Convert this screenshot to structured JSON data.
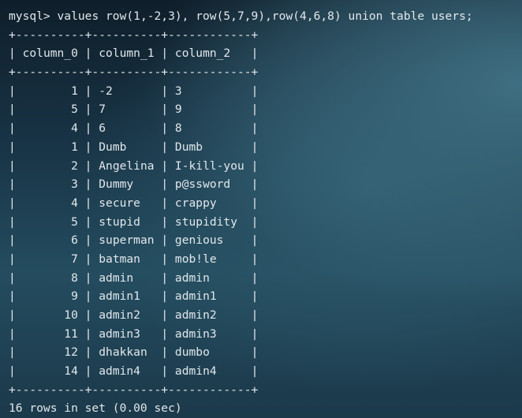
{
  "terminal": {
    "prompt": "mysql>",
    "command": "values row(1,-2,3), row(5,7,9),row(4,6,8) union table users;",
    "border": "+----------+----------+------------+",
    "columns": [
      "column_0",
      "column_1",
      "column_2"
    ],
    "rows": [
      [
        "1",
        "-2",
        "3"
      ],
      [
        "5",
        "7",
        "9"
      ],
      [
        "4",
        "6",
        "8"
      ],
      [
        "1",
        "Dumb",
        "Dumb"
      ],
      [
        "2",
        "Angelina",
        "I-kill-you"
      ],
      [
        "3",
        "Dummy",
        "p@ssword"
      ],
      [
        "4",
        "secure",
        "crappy"
      ],
      [
        "5",
        "stupid",
        "stupidity"
      ],
      [
        "6",
        "superman",
        "genious"
      ],
      [
        "7",
        "batman",
        "mob!le"
      ],
      [
        "8",
        "admin",
        "admin"
      ],
      [
        "9",
        "admin1",
        "admin1"
      ],
      [
        "10",
        "admin2",
        "admin2"
      ],
      [
        "11",
        "admin3",
        "admin3"
      ],
      [
        "12",
        "dhakkan",
        "dumbo"
      ],
      [
        "14",
        "admin4",
        "admin4"
      ]
    ],
    "result_summary": "16 rows in set (0.00 sec)"
  }
}
